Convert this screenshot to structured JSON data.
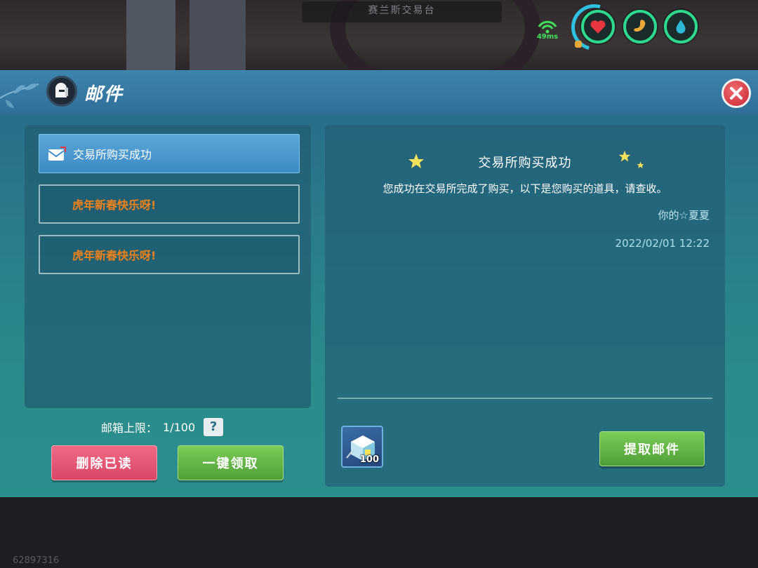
{
  "hud": {
    "zone_name": "赛兰斯交易台",
    "ping": "49ms",
    "stats": [
      {
        "name": "health",
        "icon": "heart-icon",
        "color": "#e8373f"
      },
      {
        "name": "hunger",
        "icon": "stomach-icon",
        "color": "#e8a837"
      },
      {
        "name": "thirst",
        "icon": "water-drop-icon",
        "color": "#2fb7d6"
      }
    ]
  },
  "panel": {
    "title": "邮件",
    "close_icon": "close-icon"
  },
  "mail_list": {
    "items": [
      {
        "label": "交易所购买成功",
        "selected": true,
        "read": true
      },
      {
        "label": "虎年新春快乐呀!",
        "selected": false,
        "read": false
      },
      {
        "label": "虎年新春快乐呀!",
        "selected": false,
        "read": false
      }
    ],
    "limit_label": "邮箱上限：",
    "limit_value": "1/100",
    "help_label": "?",
    "delete_read_label": "删除已读",
    "claim_all_label": "一键领取"
  },
  "mail_detail": {
    "title": "交易所购买成功",
    "body": "您成功在交易所完成了购买，以下是您购买的道具，请查收。",
    "sender": "你的☆夏夏",
    "time": "2022/02/01 12:22",
    "attachment": {
      "icon": "cube-item-icon",
      "count": "100"
    },
    "claim_label": "提取邮件"
  },
  "footer": {
    "player_id": "62897316"
  },
  "colors": {
    "accent_orange": "#f38219",
    "button_red": "#d84567",
    "button_green": "#4f9f37",
    "selected_blue": "#3c8bc4"
  }
}
